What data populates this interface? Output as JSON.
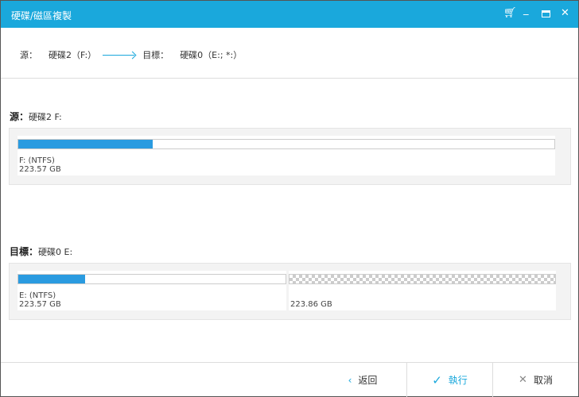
{
  "window": {
    "title": "硬碟/磁區複製",
    "accent": "#1aa8dc"
  },
  "path": {
    "source_label": "源：",
    "source_value": "硬碟2（F:）",
    "target_label": "目標：",
    "target_value": "硬碟0（E:; *:）"
  },
  "source": {
    "label": "源：",
    "disk": "硬碟2 F:",
    "partitions": [
      {
        "name": "F: (NTFS)",
        "size": "223.57 GB",
        "used_percent": 25
      }
    ]
  },
  "target": {
    "label": "目標：",
    "disk": "硬碟0 E:",
    "partitions": [
      {
        "name": "E: (NTFS)",
        "size": "223.57 GB",
        "used_percent": 25
      },
      {
        "name": "",
        "size": "223.86 GB",
        "unallocated": true
      }
    ]
  },
  "footer": {
    "back": "返回",
    "execute": "執行",
    "cancel": "取消"
  }
}
